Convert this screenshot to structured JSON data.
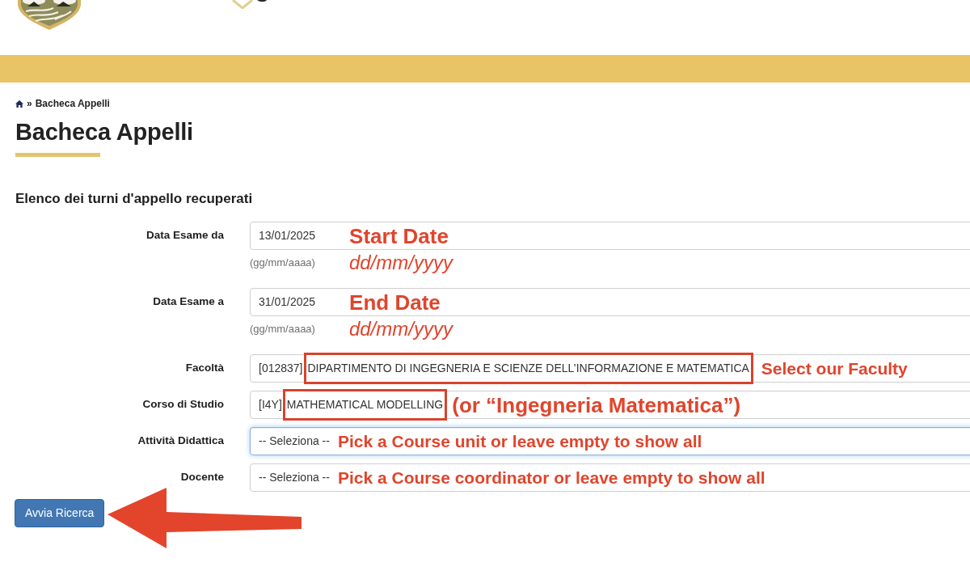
{
  "breadcrumb": {
    "separator": "»",
    "current": "Bacheca Appelli"
  },
  "page_title": "Bacheca Appelli",
  "section_title": "Elenco dei turni d'appello recuperati",
  "fields": [
    {
      "kind": "date",
      "label": "Data Esame da",
      "value": "13/01/2025",
      "focused": false,
      "boxed": false,
      "hint": "(gg/mm/aaaa)",
      "note": "Start Date",
      "note_hint": "dd/mm/yyyy"
    },
    {
      "kind": "date",
      "label": "Data Esame a",
      "value": "31/01/2025",
      "focused": false,
      "boxed": false,
      "hint": "(gg/mm/aaaa)",
      "note": "End Date",
      "note_hint": "dd/mm/yyyy"
    },
    {
      "kind": "select",
      "label": "Facoltà",
      "code": "[012837]",
      "value": "DIPARTIMENTO DI INGEGNERIA E SCIENZE DELL’INFORMAZIONE E MATEMATICA",
      "focused": false,
      "boxed": true,
      "note": "Select our Faculty"
    },
    {
      "kind": "select",
      "label": "Corso di Studio",
      "code": "[I4Y]",
      "value": "MATHEMATICAL MODELLING",
      "focused": false,
      "boxed": true,
      "note": "(or “Ingegneria Matematica”)"
    },
    {
      "kind": "select",
      "label": "Attività Didattica",
      "value": "-- Seleziona --",
      "focused": true,
      "boxed": false,
      "note": "Pick a Course unit or leave empty to show all"
    },
    {
      "kind": "select",
      "label": "Docente",
      "value": "-- Seleziona --",
      "focused": false,
      "boxed": false,
      "note": "Pick a Course coordinator or leave empty to show all"
    }
  ],
  "search_button": "Avvia Ricerca"
}
